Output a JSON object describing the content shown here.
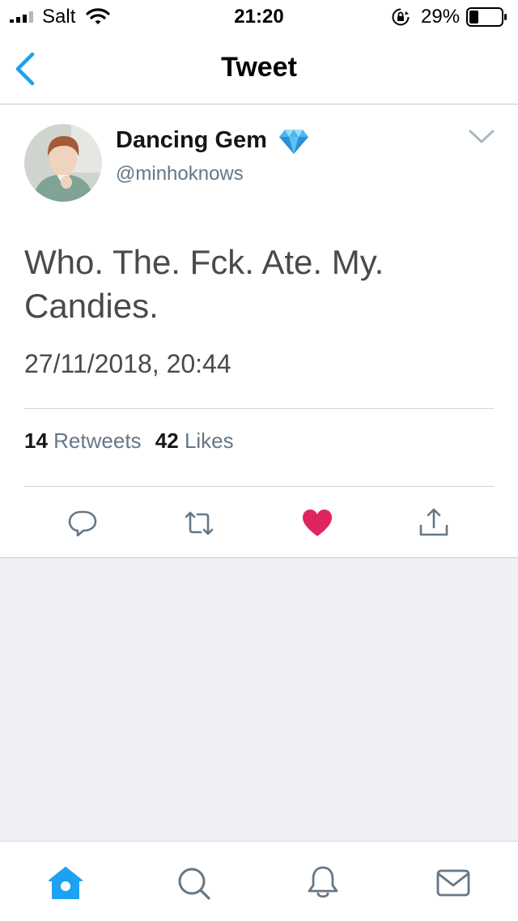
{
  "status_bar": {
    "carrier": "Salt",
    "time": "21:20",
    "battery_percent": "29%",
    "battery_level": 0.29
  },
  "nav": {
    "title": "Tweet",
    "back_icon": "chevron-left-icon"
  },
  "tweet": {
    "author_name": "Dancing Gem",
    "author_handle": "@minhoknows",
    "name_emoji": "gem-icon",
    "text": "Who. The. Fck. Ate. My. Candies.",
    "timestamp": "27/11/2018, 20:44",
    "retweets_count": "14",
    "retweets_label": "Retweets",
    "likes_count": "42",
    "likes_label": "Likes",
    "liked": true
  },
  "actions": [
    "reply-icon",
    "retweet-icon",
    "like-icon",
    "share-icon"
  ],
  "tab_bar": {
    "tabs": [
      "home-icon",
      "search-icon",
      "notifications-icon",
      "messages-icon"
    ],
    "active": "home-icon"
  },
  "colors": {
    "accent": "#1da1f2",
    "like": "#e0245e",
    "secondary_text": "#657786",
    "icon_gray": "#657786",
    "empty_background": "#efeff4"
  }
}
